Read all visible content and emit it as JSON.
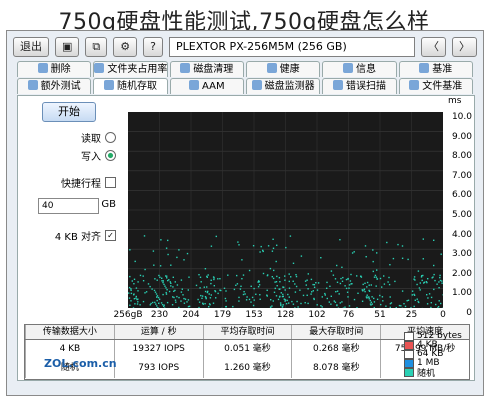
{
  "caption": "750g硬盘性能测试,750g硬盘怎么样",
  "toolbar": {
    "exit": "退出",
    "drive_select": "PLEXTOR PX-256M5M (256 GB)",
    "button_left": "〈",
    "button_right": "〉"
  },
  "tabs_row1": [
    "删除",
    "文件夹占用率",
    "磁盘清理",
    "健康",
    "信息",
    "基准"
  ],
  "tabs_row2": [
    "额外测试",
    "随机存取",
    "AAM",
    "磁盘监测器",
    "错误扫描",
    "文件基准"
  ],
  "leftcol": {
    "start": "开始",
    "opt_read": "读取",
    "opt_write": "写入",
    "chk_label": "快捷行程",
    "field_value": "40",
    "field_unit": "GB",
    "block_label": "4 KB 对齐"
  },
  "yaxis": {
    "title": "ms",
    "ticks": [
      "10.0",
      "9.00",
      "8.00",
      "7.00",
      "6.00",
      "5.00",
      "4.00",
      "3.00",
      "2.00",
      "1.00",
      "0"
    ]
  },
  "xaxis": {
    "ticks": [
      "256gB",
      "230",
      "204",
      "179",
      "153",
      "128",
      "102",
      "76",
      "51",
      "25",
      "0"
    ]
  },
  "table": {
    "headers": [
      "传输数据大小",
      "运算 / 秒",
      "平均存取时间",
      "最大存取时间",
      "平均速度"
    ],
    "rows": [
      [
        "4 KB",
        "19327 IOPS",
        "0.051 毫秒",
        "0.268 毫秒",
        "75.499 MB/秒"
      ],
      [
        "随机",
        "793 IOPS",
        "1.260 毫秒",
        "8.078 毫秒",
        ""
      ]
    ]
  },
  "legend": [
    {
      "label": "512 bytes",
      "color": "#ffffff"
    },
    {
      "label": "4 KB",
      "color": "#e85454"
    },
    {
      "label": "64 KB",
      "color": "#ffffff"
    },
    {
      "label": "1 MB",
      "color": "#1e8fe0"
    },
    {
      "label": "随机",
      "color": "#2ad0b4"
    }
  ],
  "watermark": "ZOL.com.cn",
  "colors": {
    "plot_bg": "#1a1a1a",
    "dots": "#2ad0b4",
    "accent": "#1b5ea8"
  }
}
